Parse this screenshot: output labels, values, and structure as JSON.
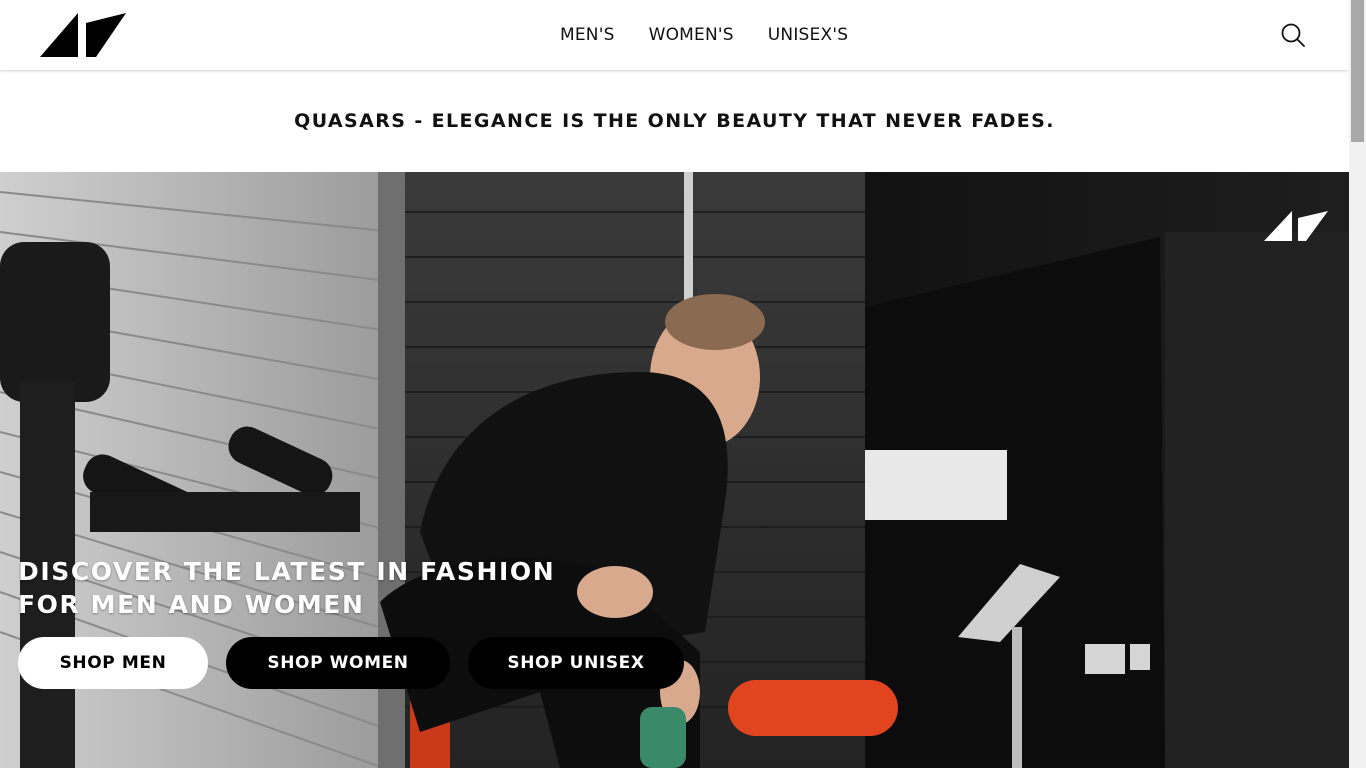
{
  "header": {
    "logo_icon": "brand-logo-icon",
    "nav": [
      {
        "label": "MEN'S"
      },
      {
        "label": "WOMEN'S"
      },
      {
        "label": "UNISEX'S"
      }
    ],
    "search_icon": "search-icon"
  },
  "tagline": "QUASARS - ELEGANCE IS THE ONLY BEAUTY THAT NEVER FADES.",
  "hero": {
    "heading_line1": "DISCOVER THE LATEST IN FASHION",
    "heading_line2": "FOR MEN AND WOMEN",
    "buttons": {
      "men": "SHOP MEN",
      "women": "SHOP WOMEN",
      "unisex": "SHOP UNISEX"
    }
  },
  "colors": {
    "background": "#ffffff",
    "text": "#111111",
    "button_dark": "#000000",
    "button_light": "#ffffff",
    "accent_orange": "#e0451f"
  }
}
